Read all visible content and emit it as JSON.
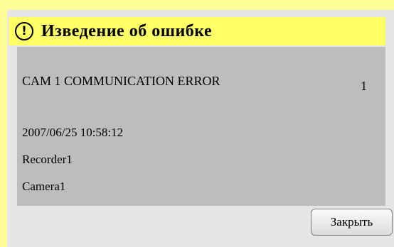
{
  "dialog": {
    "title": "Изведение об ошибке",
    "icon": "warning-icon",
    "accent_color": "#ffff66"
  },
  "error": {
    "message": "CAM 1 COMMUNICATION ERROR",
    "count": "1",
    "timestamp": "2007/06/25 10:58:12",
    "recorder": "Recorder1",
    "camera": "Camera1"
  },
  "buttons": {
    "close_label": "Закрыть"
  }
}
